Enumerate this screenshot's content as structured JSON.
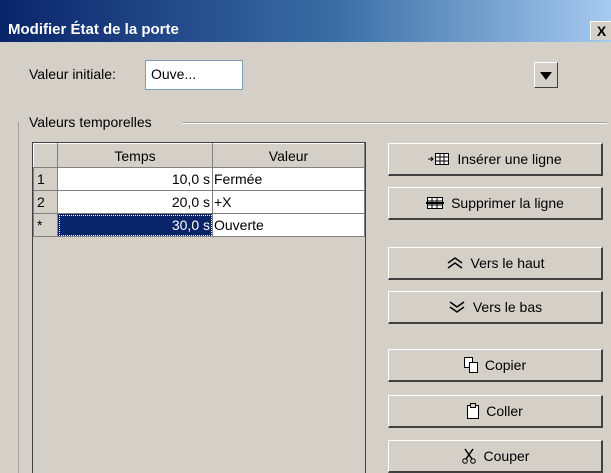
{
  "window": {
    "title": "Modifier État de la porte",
    "close_label": "X"
  },
  "initial_value": {
    "label": "Valeur initiale:",
    "selected": "Ouve..."
  },
  "group": {
    "label": "Valeurs temporelles"
  },
  "table": {
    "columns": [
      "Temps",
      "Valeur"
    ],
    "rows": [
      {
        "index": "1",
        "time": "10,0 s",
        "value": "Fermée"
      },
      {
        "index": "2",
        "time": "20,0 s",
        "value": "+X"
      },
      {
        "index": "*",
        "time": "30,0 s",
        "value": "Ouverte"
      }
    ],
    "selected_row": 2
  },
  "buttons": {
    "insert": "Insérer une ligne",
    "delete": "Supprimer la ligne",
    "up": "Vers le haut",
    "down": "Vers le bas",
    "copy": "Copier",
    "paste": "Coller",
    "cut": "Couper"
  },
  "icons": {
    "insert": "insert-row-icon",
    "delete": "delete-row-icon",
    "up": "double-chevron-up-icon",
    "down": "double-chevron-down-icon",
    "copy": "copy-icon",
    "paste": "paste-icon",
    "cut": "scissors-icon"
  }
}
